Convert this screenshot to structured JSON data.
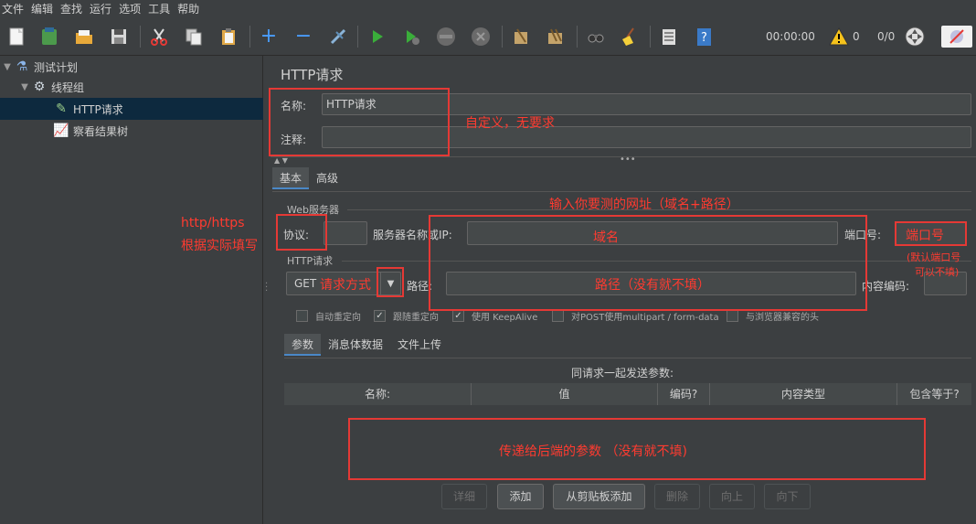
{
  "menu": [
    "文件",
    "编辑",
    "查找",
    "运行",
    "选项",
    "工具",
    "帮助"
  ],
  "toolbar": {
    "timer": "00:00:00",
    "warnings": "0",
    "threads": "0/0",
    "icons": {
      "new": "new-file-icon",
      "templates": "templates-icon",
      "open": "open-folder-icon",
      "save": "save-icon",
      "cut": "cut-icon",
      "copy": "copy-icon",
      "paste": "paste-icon",
      "expand": "plus-icon",
      "collapse": "minus-icon",
      "toggle": "toggle-icon",
      "start": "start-icon",
      "start_no_pause": "start-no-pause-icon",
      "stop": "stop-icon",
      "shutdown": "shutdown-icon",
      "clear": "clear-icon",
      "clear_all": "clear-all-icon",
      "search": "binoculars-icon",
      "reset_search": "broom-icon",
      "function_helper": "function-helper-icon",
      "help": "help-icon",
      "warning": "warning-icon",
      "remote": "remote-icon",
      "plugin": "plugin-icon"
    }
  },
  "tree": {
    "items": [
      {
        "label": "测试计划"
      },
      {
        "label": "线程组"
      },
      {
        "label": "HTTP请求"
      },
      {
        "label": "察看结果树"
      }
    ]
  },
  "panel": {
    "title": "HTTP请求",
    "name_label": "名称:",
    "name_value": "HTTP请求",
    "comment_label": "注释:",
    "comment_value": "",
    "tabs": [
      "基本",
      "高级"
    ],
    "web_server": {
      "section": "Web服务器",
      "protocol_label": "协议:",
      "protocol_value": "",
      "server_label": "服务器名称或IP:",
      "server_value": "",
      "port_label": "端口号:",
      "port_value": ""
    },
    "http_request": {
      "section": "HTTP请求",
      "method": "GET",
      "path_label": "路径:",
      "path_value": "",
      "encoding_label": "内容编码:",
      "encoding_value": ""
    },
    "options": [
      {
        "label": "自动重定向",
        "checked": false
      },
      {
        "label": "跟随重定向",
        "checked": true
      },
      {
        "label": "使用 KeepAlive",
        "checked": true
      },
      {
        "label": "对POST使用multipart / form-data",
        "checked": false
      },
      {
        "label": "与浏览器兼容的头",
        "checked": false
      }
    ],
    "sub_tabs": [
      "参数",
      "消息体数据",
      "文件上传"
    ],
    "table_caption": "同请求一起发送参数:",
    "columns": [
      "名称:",
      "值",
      "编码?",
      "内容类型",
      "包含等于?"
    ],
    "buttons": [
      "详细",
      "添加",
      "从剪贴板添加",
      "删除",
      "向上",
      "向下"
    ]
  },
  "annotations": {
    "name": "自定义，无要求",
    "protocol_1": "http/https",
    "protocol_2": "根据实际填写",
    "url": "输入你要测的网址（域名+路径）",
    "domain": "域名",
    "port": "端口号",
    "port_note_1": "(默认端口号",
    "port_note_2": "可以不填)",
    "method": "请求方式",
    "path": "路径（没有就不填）",
    "params": "传递给后端的参数 （没有就不填)"
  }
}
